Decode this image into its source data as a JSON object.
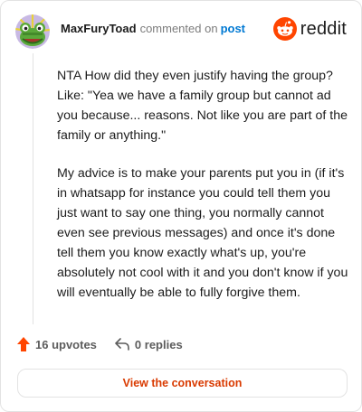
{
  "comment": {
    "author": "MaxFuryToad",
    "action": "commented on",
    "target": "post",
    "paragraphs": [
      "NTA How did they even justify having the group? Like: \"Yea we have a family group but cannot ad you because... reasons. Not like you are part of the family or anything.\"",
      "My advice is to make your parents put you in (if it's in whatsapp for instance you could tell them you just want to say one thing, you normally cannot even see previous messages) and once it's done tell them you know exactly what's up, you're absolutely not cool with it and you don't know if you will eventually be able to fully forgive them."
    ]
  },
  "brand": {
    "name": "reddit",
    "icon": "reddit-logo-icon",
    "color": "#ff4500"
  },
  "stats": {
    "upvotes_label": "16 upvotes",
    "replies_label": "0 replies",
    "upvote_icon": "upvote-arrow-icon",
    "reply_icon": "reply-arrow-icon",
    "upvote_color": "#ff4500"
  },
  "cta": {
    "label": "View the conversation",
    "color": "#d93a00"
  }
}
